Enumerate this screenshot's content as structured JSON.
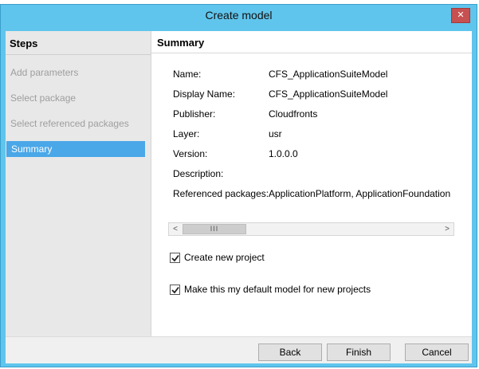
{
  "window": {
    "title": "Create model"
  },
  "sidebar": {
    "header": "Steps",
    "items": [
      {
        "label": "Add parameters",
        "active": false
      },
      {
        "label": "Select package",
        "active": false
      },
      {
        "label": "Select referenced packages",
        "active": false
      },
      {
        "label": "Summary",
        "active": true
      }
    ]
  },
  "summary": {
    "header": "Summary",
    "fields": [
      {
        "label": "Name:",
        "value": "CFS_ApplicationSuiteModel"
      },
      {
        "label": "Display Name:",
        "value": "CFS_ApplicationSuiteModel"
      },
      {
        "label": "Publisher:",
        "value": "Cloudfronts"
      },
      {
        "label": "Layer:",
        "value": "usr"
      },
      {
        "label": "Version:",
        "value": "1.0.0.0"
      },
      {
        "label": "Description:",
        "value": ""
      },
      {
        "label": "Referenced packages:",
        "value": "ApplicationPlatform, ApplicationFoundation"
      }
    ],
    "scrollbar": {
      "left_arrow": "<",
      "right_arrow": ">",
      "thumb_grip": "III"
    },
    "checkboxes": [
      {
        "label": "Create new project",
        "checked": true
      },
      {
        "label": "Make this my default model for new projects",
        "checked": true
      }
    ]
  },
  "footer": {
    "back_label": "Back",
    "finish_label": "Finish",
    "cancel_label": "Cancel"
  },
  "colors": {
    "title_bar": "#60c5ec",
    "active_step": "#4aa7e8",
    "close_button": "#c75050"
  },
  "icons": {
    "close": "close-icon",
    "check": "checkmark-icon"
  }
}
